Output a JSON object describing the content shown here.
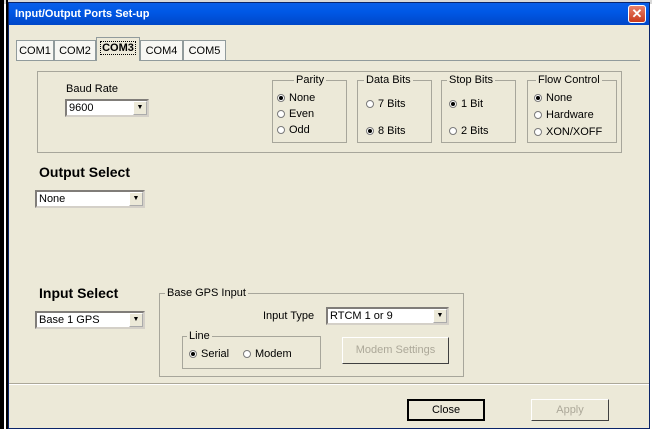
{
  "window": {
    "title": "Input/Output Ports Set-up",
    "close_glyph": "✕"
  },
  "tabs": [
    {
      "label": "COM1",
      "active": false
    },
    {
      "label": "COM2",
      "active": false
    },
    {
      "label": "COM3",
      "active": true
    },
    {
      "label": "COM4",
      "active": false
    },
    {
      "label": "COM5",
      "active": false
    }
  ],
  "baud": {
    "label": "Baud Rate",
    "value": "9600"
  },
  "parity": {
    "label": "Parity",
    "options": [
      "None",
      "Even",
      "Odd"
    ],
    "selected": "None"
  },
  "data_bits": {
    "label": "Data Bits",
    "options": [
      "7 Bits",
      "8 Bits"
    ],
    "selected": "8 Bits"
  },
  "stop_bits": {
    "label": "Stop Bits",
    "options": [
      "1 Bit",
      "2 Bits"
    ],
    "selected": "1 Bit"
  },
  "flow_control": {
    "label": "Flow Control",
    "options": [
      "None",
      "Hardware",
      "XON/XOFF"
    ],
    "selected": "None"
  },
  "output_select": {
    "label": "Output Select",
    "value": "None"
  },
  "input_select": {
    "label": "Input Select",
    "value": "Base 1 GPS"
  },
  "base_gps": {
    "label": "Base GPS Input",
    "input_type_label": "Input Type",
    "input_type_value": "RTCM 1 or 9",
    "line": {
      "label": "Line",
      "options": [
        "Serial",
        "Modem"
      ],
      "selected": "Serial"
    },
    "modem_settings_label": "Modem Settings"
  },
  "buttons": {
    "close": "Close",
    "apply": "Apply"
  },
  "icons": {
    "dropdown": "chevron-down-icon",
    "close": "close-icon"
  },
  "colors": {
    "titlebar": "#0058e6",
    "face": "#ece9d8",
    "close": "#c93a1d"
  }
}
